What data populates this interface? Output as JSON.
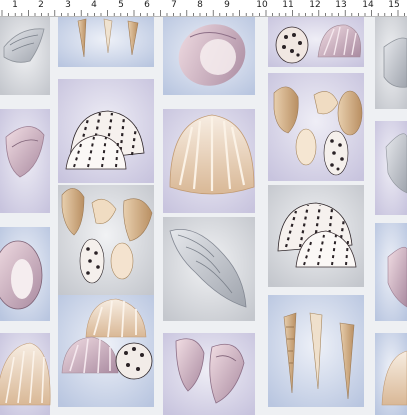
{
  "ruler": {
    "labels": [
      "1",
      "2",
      "3",
      "4",
      "5",
      "6",
      "7",
      "8",
      "9",
      "10",
      "11",
      "12",
      "13",
      "14",
      "15"
    ]
  },
  "colors": {
    "background": "#eef0f3",
    "tile_blue": "#c9d3e6",
    "tile_lavender": "#d6d4e6",
    "tile_grey": "#d4d6da",
    "shell_cream": "#f3e6d6",
    "shell_tan": "#d8b48a",
    "shell_pink": "#e3c7cf",
    "shell_purple": "#9a7f95",
    "shell_grey": "#c7cbd2",
    "spots": "#2a2226"
  }
}
